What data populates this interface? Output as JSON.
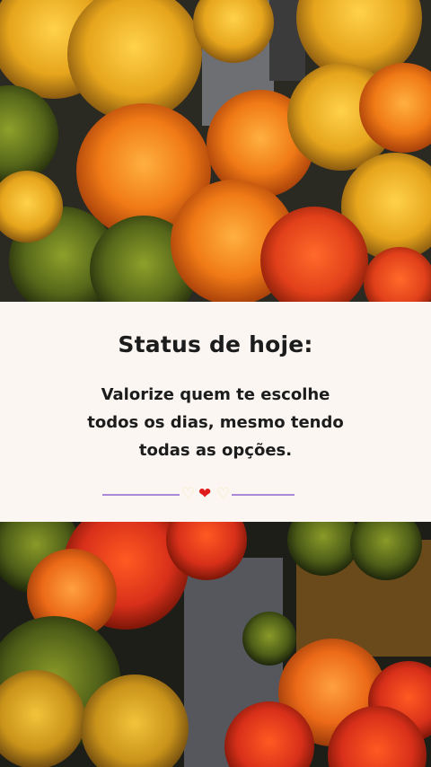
{
  "card": {
    "title": "Status de hoje:",
    "message_lines": [
      "Valorize quem te escolhe",
      "todos os dias, mesmo tendo",
      "todas as opções."
    ]
  },
  "divider": {
    "hearts": [
      "♡",
      "❤",
      "♡"
    ],
    "line_color": "#a988d8",
    "heart_color": "#e01b1b"
  },
  "images": {
    "top": "autumn-forest-aerial-photo",
    "bottom": "autumn-forest-aerial-photo"
  }
}
